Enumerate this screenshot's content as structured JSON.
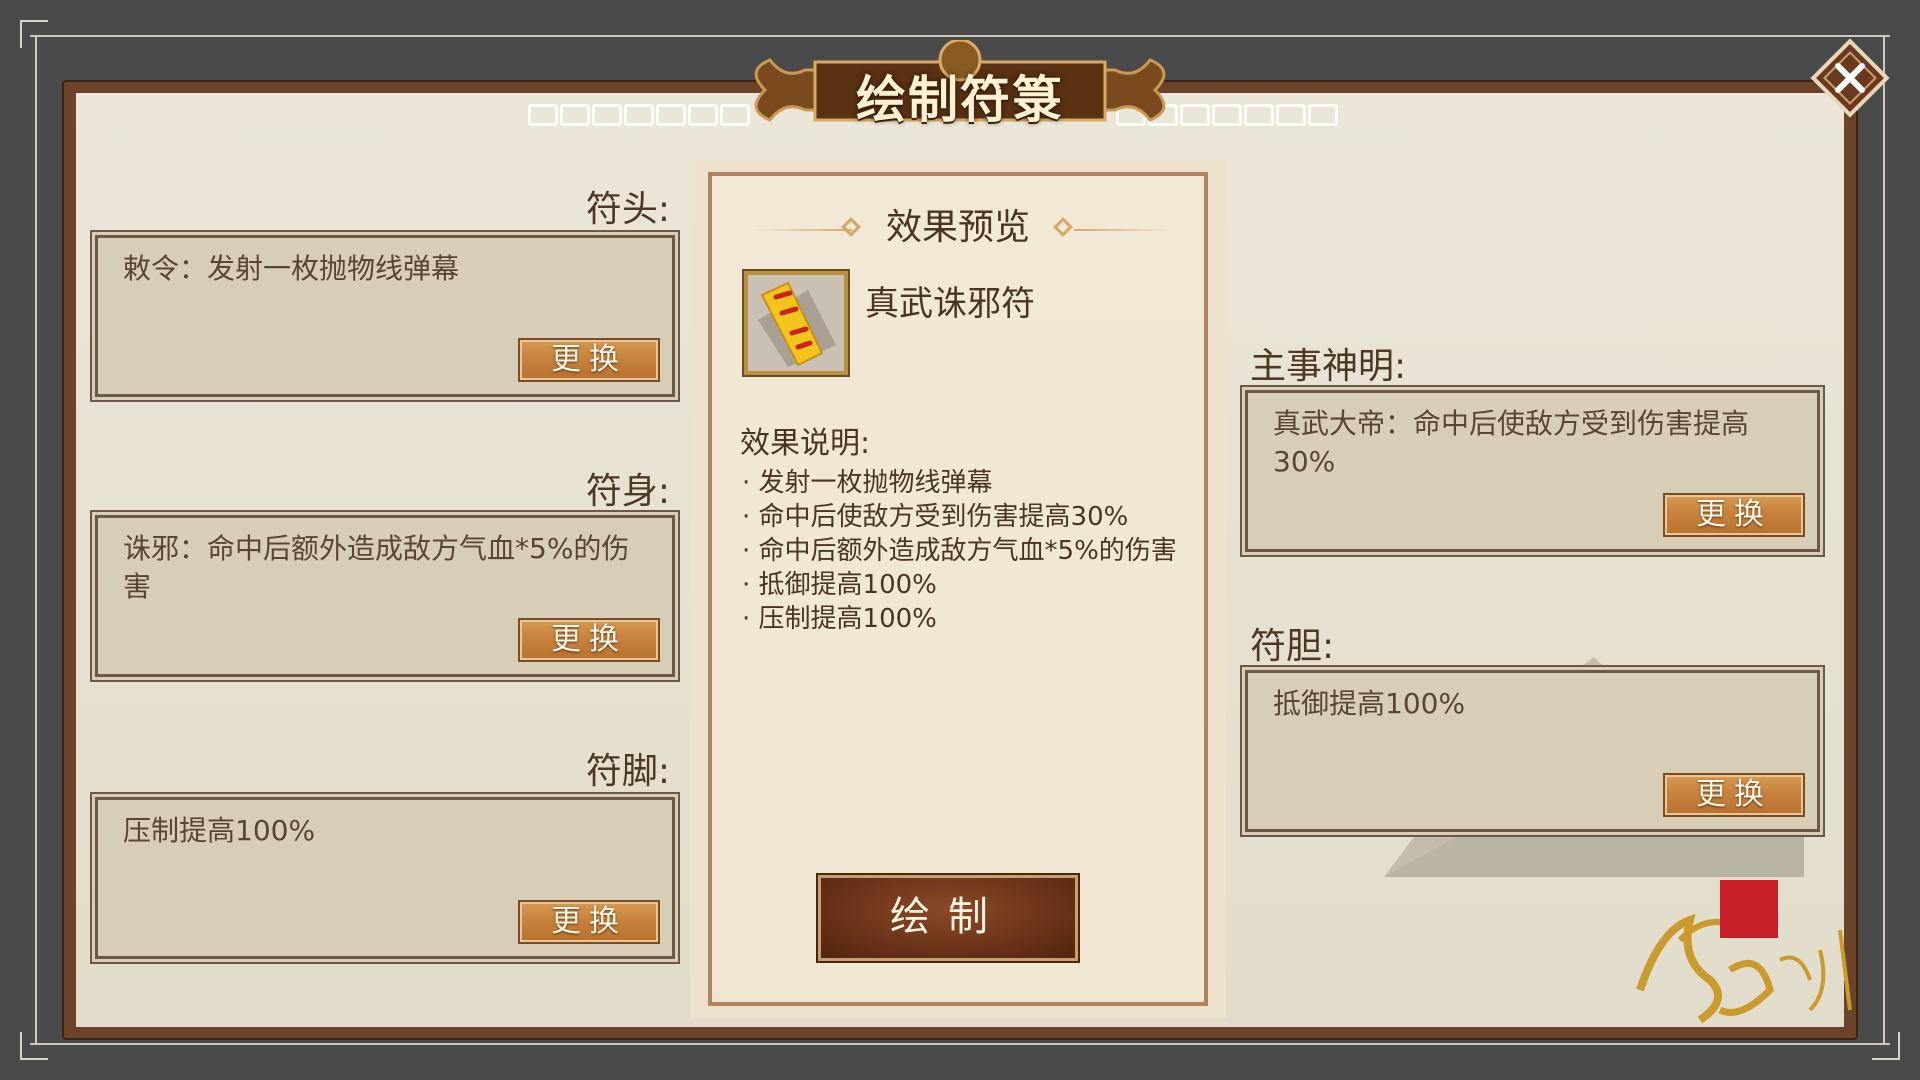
{
  "title": "绘制符箓",
  "slots_left": [
    {
      "label": "符头:",
      "text": "敕令：发射一枚抛物线弹幕",
      "button": "更换"
    },
    {
      "label": "符身:",
      "text": "诛邪：命中后额外造成敌方气血*5%的伤害",
      "button": "更换"
    },
    {
      "label": "符脚:",
      "text": "压制提高100%",
      "button": "更换"
    }
  ],
  "slots_right": [
    {
      "label": "主事神明:",
      "text": "真武大帝：命中后使敌方受到伤害提高30%",
      "button": "更换"
    },
    {
      "label": "符胆:",
      "text": "抵御提高100%",
      "button": "更换"
    }
  ],
  "preview": {
    "title": "效果预览",
    "talisman_name": "真武诛邪符",
    "effect_heading": "效果说明:",
    "effects": [
      "发射一枚抛物线弹幕",
      "命中后使敌方受到伤害提高30%",
      "命中后额外造成敌方气血*5%的伤害",
      "抵御提高100%",
      "压制提高100%"
    ],
    "draw_button": "绘制"
  },
  "icons": {
    "close": "close-icon",
    "talisman": "talisman-icon",
    "logo": "game-logo"
  },
  "colors": {
    "frame": "#6b4328",
    "parchment": "#e8e2d3",
    "button": "#c8843f",
    "draw_button": "#6a3318"
  }
}
